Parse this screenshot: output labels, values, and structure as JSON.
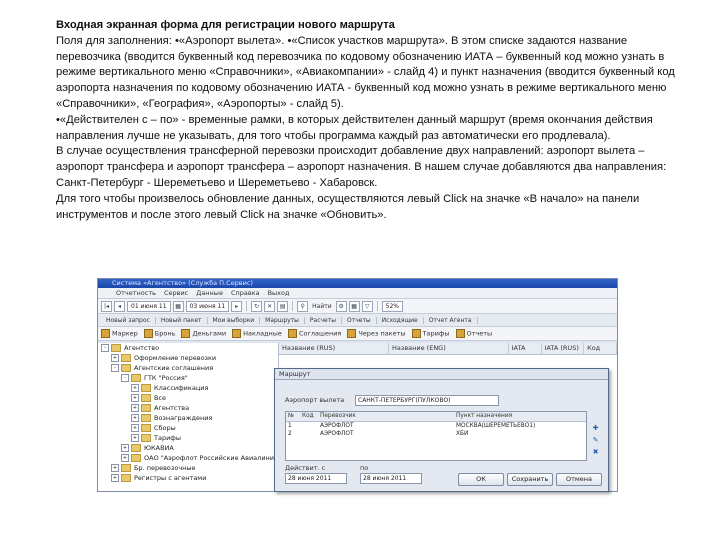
{
  "document": {
    "title": "Входная экранная форма для регистрации нового маршрута",
    "paragraphs": [
      "Поля для заполнения: •«Аэропорт вылета». •«Список участков маршрута». В этом списке задаются название перевозчика (вводится буквенный код перевозчика по кодовому обозначению ИАТА – буквенный код можно узнать в режиме вертикального меню «Справочники», «Авиакомпании» - слайд 4) и пункт назначения (вводится буквенный код аэропорта назначения по кодовому обозначению ИАТА - буквенный код можно узнать в режиме вертикального меню «Справочники», «География», «Аэропорты» - слайд 5).",
      "•«Действителен с – по» - временные рамки, в которых действителен данный маршрут (время окончания действия направления лучше не указывать, для того чтобы программа каждый раз автоматически его продлевала).",
      "В случае осуществления трансферной перевозки происходит добавление двух направлений: аэропорт вылета – аэропорт трансфера и аэропорт трансфера – аэропорт назначения. В нашем случае добавляются два направления: Санкт-Петербург - Шереметьево и Шереметьево - Хабаровск.",
      "Для того чтобы произвелось обновление данных, осуществляются левый Click на значке «В начало» на панели инструментов и после этого левый Click на значке «Обновить»."
    ]
  },
  "app": {
    "window_title": "Система «Агентство» (Служба П.Сервис)",
    "menu": [
      "Отчетность",
      "Сервис",
      "Данные",
      "Справка",
      "Выход"
    ],
    "toolbar": {
      "date_from": "01 июня 11",
      "date_to": "03 июня 11",
      "search_label": "Найти",
      "zoom": "52%"
    },
    "tabs": [
      "Новый запрос",
      "Новый пакет",
      "Мои выборки",
      "Маршруты",
      "Расчеты",
      "Отчеты",
      "Исходящие",
      "Отчет Агента"
    ],
    "actions": [
      "Маркер",
      "Бронь",
      "Деньгами",
      "Накладные",
      "Соглашения",
      "Через пакеты",
      "Тарифы",
      "Отчеты"
    ],
    "tree": [
      {
        "level": 0,
        "label": "Агентство",
        "expand": "-"
      },
      {
        "level": 1,
        "label": "Оформление перевозки",
        "expand": "+"
      },
      {
        "level": 1,
        "label": "Агентские соглашения",
        "expand": "-"
      },
      {
        "level": 2,
        "label": "ГТК \"Россия\"",
        "expand": "-"
      },
      {
        "level": 3,
        "label": "Классификация",
        "expand": "+"
      },
      {
        "level": 3,
        "label": "Все",
        "expand": "+"
      },
      {
        "level": 3,
        "label": "Агентства",
        "expand": "+"
      },
      {
        "level": 3,
        "label": "Вознаграждения",
        "expand": "+"
      },
      {
        "level": 3,
        "label": "Сборы",
        "expand": "+"
      },
      {
        "level": 3,
        "label": "Тарифы",
        "expand": "+"
      },
      {
        "level": 2,
        "label": "ЮКАВИА",
        "expand": "+"
      },
      {
        "level": 2,
        "label": "ОАО \"Аэрофлот Российские Авиалинии\"",
        "expand": "+"
      },
      {
        "level": 1,
        "label": "Бр. перевозочные",
        "expand": "+"
      },
      {
        "level": 1,
        "label": "Регистры с агентами",
        "expand": "+"
      }
    ],
    "grid_headers": [
      "Название (RUS)",
      "Название (ENG)",
      "IATA",
      "IATA (RUS)",
      "Код"
    ]
  },
  "dialog": {
    "title": "Маршрут",
    "airport_label": "Аэропорт вылета",
    "airport_value": "САНКТ-ПЕТЕРБУРГ(ПУЛКОВО)",
    "table_headers": [
      "№",
      "Код",
      "Перевозчик",
      "Пункт назначения"
    ],
    "rows": [
      {
        "n": "1",
        "carrier": "АЭРОФЛОТ",
        "dest": "МОСКВА(ШЕРЕМЕТЬЕВО1)"
      },
      {
        "n": "2",
        "carrier": "АЭРОФЛОТ",
        "dest": "ХБИ"
      }
    ],
    "valid_from_label": "Действит. с",
    "valid_to_label": "по",
    "date_from": "28 июня 2011",
    "date_to": "28 июня 2011",
    "ok_label": "ОК",
    "save_label": "Сохранить",
    "cancel_label": "Отмена"
  }
}
